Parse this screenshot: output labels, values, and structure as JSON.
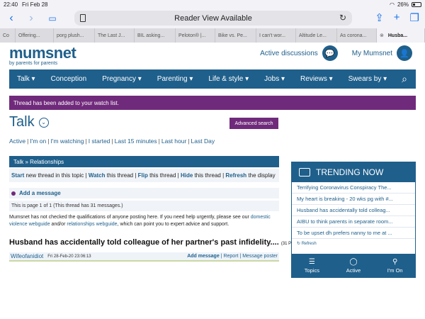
{
  "status_bar": {
    "time": "22:40",
    "date": "Fri Feb 28",
    "battery": "26%"
  },
  "safari": {
    "reader_view": "Reader View Available"
  },
  "tabs": [
    "Co",
    "Offering...",
    "porg plush...",
    "The Last J...",
    "BIL asking...",
    "Peloton® |...",
    "Bike vs. Pe...",
    "I can't wor...",
    "Altitude Le...",
    "As corona...",
    "Husba..."
  ],
  "header": {
    "brand": "mumsnet",
    "tagline": "by parents for parents",
    "active_discussions": "Active discussions",
    "my_mumsnet": "My Mumsnet"
  },
  "nav": [
    "Talk ▾",
    "Conception",
    "Pregnancy ▾",
    "Parenting ▾",
    "Life & style ▾",
    "Jobs ▾",
    "Reviews ▾",
    "Swears by ▾"
  ],
  "notice": "Thread has been added to your watch list.",
  "talk": {
    "title": "Talk",
    "advanced_search": "Advanced search",
    "filters": [
      "Active",
      "I'm on",
      "I'm watching",
      "I started",
      "Last 15 minutes",
      "Last hour",
      "Last Day"
    ],
    "breadcrumb": "Talk » Relationships"
  },
  "thread_actions": {
    "start": "Start",
    "start_rest": " new thread in this topic | ",
    "watch": "Watch",
    "watch_rest": " this thread | ",
    "flip": "Flip",
    "flip_rest": " this thread | ",
    "hide": "Hide",
    "hide_rest": " this thread | ",
    "refresh": "Refresh",
    "refresh_rest": " the display"
  },
  "add_message": "Add a message",
  "page_info": "This is page 1 of 1 (This thread has 31 messages.)",
  "disclaimer": {
    "part1": "Mumsnet has not checked the qualifications of anyone posting here. If you need help urgently, please see our ",
    "link1": "domestic violence webguide",
    "part2": " and/or ",
    "link2": "relationships webguide",
    "part3": ", which can point you to expert advice and support."
  },
  "thread": {
    "title": "Husband has accidentally told colleague of her partner's past infidelity....",
    "count": "(31 Posts)"
  },
  "post": {
    "author": "Wifeofanidiot",
    "date": "Fri 28-Feb-20 23:06:13",
    "add_message": "Add message",
    "sep1": " | ",
    "report": "Report",
    "sep2": " | ",
    "message_poster": "Message poster"
  },
  "trending": {
    "title": "TRENDING NOW",
    "items": [
      "Terrifying Coronavirus Conspiracy The...",
      "My heart is breaking - 20 wks pg with #...",
      "Husband has accidentally told colleag...",
      "AIBU to think parents in separate room...",
      "To be upset dh prefers nanny to me at ..."
    ],
    "refresh": "Refresh",
    "tabs": [
      "Topics",
      "Active",
      "I'm On"
    ]
  }
}
